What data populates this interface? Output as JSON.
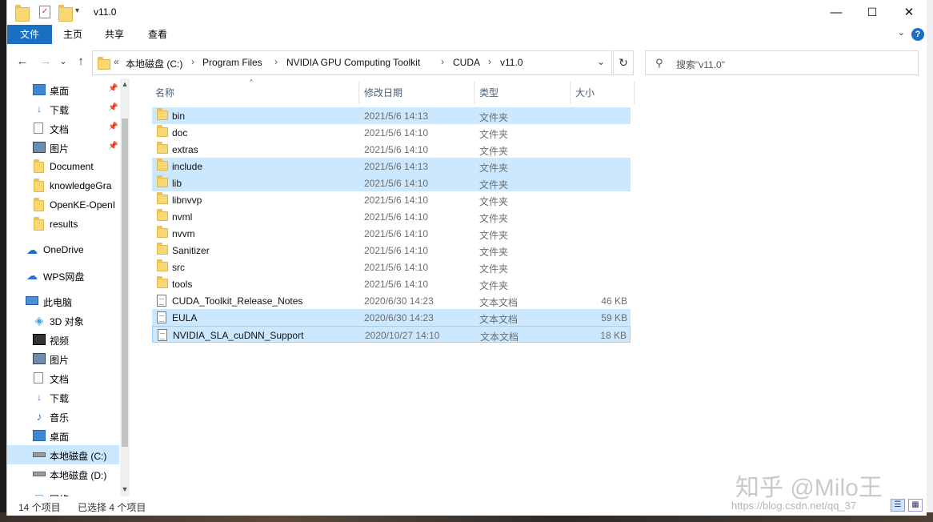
{
  "window": {
    "title": "v11.0",
    "controls": {
      "minimize": "—",
      "maximize": "☐",
      "close": "✕"
    }
  },
  "ribbon": {
    "tabs": [
      "文件",
      "主页",
      "共享",
      "查看"
    ],
    "help": "?"
  },
  "nav": {
    "back": "←",
    "forward": "→",
    "recent": "⌄",
    "up": "↑",
    "refresh": "↻",
    "breadcrumb_prefix": "«",
    "breadcrumb": [
      "本地磁盘 (C:)",
      "Program Files",
      "NVIDIA GPU Computing Toolkit",
      "CUDA",
      "v11.0"
    ],
    "dropdown": "⌄",
    "search_placeholder": "搜索\"v11.0\""
  },
  "sidebar": {
    "items": [
      {
        "label": "桌面",
        "icon": "desktop-icon",
        "pinned": true
      },
      {
        "label": "下载",
        "icon": "download-icon",
        "pinned": true
      },
      {
        "label": "文档",
        "icon": "document-icon",
        "pinned": true
      },
      {
        "label": "图片",
        "icon": "pictures-icon",
        "pinned": true
      },
      {
        "label": "Document",
        "icon": "folder-icon"
      },
      {
        "label": "knowledgeGra",
        "icon": "folder-icon"
      },
      {
        "label": "OpenKE-OpenI",
        "icon": "folder-icon"
      },
      {
        "label": "results",
        "icon": "folder-icon"
      },
      {
        "label": "OneDrive",
        "icon": "onedrive-icon"
      },
      {
        "label": "WPS网盘",
        "icon": "wps-cloud-icon"
      },
      {
        "label": "此电脑",
        "icon": "this-pc-icon"
      },
      {
        "label": "3D 对象",
        "icon": "3d-objects-icon"
      },
      {
        "label": "视频",
        "icon": "video-icon"
      },
      {
        "label": "图片",
        "icon": "pictures-icon"
      },
      {
        "label": "文档",
        "icon": "document-icon"
      },
      {
        "label": "下载",
        "icon": "download-icon"
      },
      {
        "label": "音乐",
        "icon": "music-icon"
      },
      {
        "label": "桌面",
        "icon": "desktop-icon"
      },
      {
        "label": "本地磁盘 (C:)",
        "icon": "drive-icon",
        "selected": true
      },
      {
        "label": "本地磁盘 (D:)",
        "icon": "drive-icon"
      },
      {
        "label": "网络",
        "icon": "network-icon"
      }
    ]
  },
  "columns": {
    "name": "名称",
    "date": "修改日期",
    "type": "类型",
    "size": "大小"
  },
  "files": [
    {
      "name": "bin",
      "date": "2021/5/6 14:13",
      "type": "文件夹",
      "size": "",
      "kind": "folder",
      "selected": true
    },
    {
      "name": "doc",
      "date": "2021/5/6 14:10",
      "type": "文件夹",
      "size": "",
      "kind": "folder"
    },
    {
      "name": "extras",
      "date": "2021/5/6 14:10",
      "type": "文件夹",
      "size": "",
      "kind": "folder"
    },
    {
      "name": "include",
      "date": "2021/5/6 14:13",
      "type": "文件夹",
      "size": "",
      "kind": "folder",
      "selected": true
    },
    {
      "name": "lib",
      "date": "2021/5/6 14:10",
      "type": "文件夹",
      "size": "",
      "kind": "folder",
      "selected": true
    },
    {
      "name": "libnvvp",
      "date": "2021/5/6 14:10",
      "type": "文件夹",
      "size": "",
      "kind": "folder"
    },
    {
      "name": "nvml",
      "date": "2021/5/6 14:10",
      "type": "文件夹",
      "size": "",
      "kind": "folder"
    },
    {
      "name": "nvvm",
      "date": "2021/5/6 14:10",
      "type": "文件夹",
      "size": "",
      "kind": "folder"
    },
    {
      "name": "Sanitizer",
      "date": "2021/5/6 14:10",
      "type": "文件夹",
      "size": "",
      "kind": "folder"
    },
    {
      "name": "src",
      "date": "2021/5/6 14:10",
      "type": "文件夹",
      "size": "",
      "kind": "folder"
    },
    {
      "name": "tools",
      "date": "2021/5/6 14:10",
      "type": "文件夹",
      "size": "",
      "kind": "folder"
    },
    {
      "name": "CUDA_Toolkit_Release_Notes",
      "date": "2020/6/30 14:23",
      "type": "文本文档",
      "size": "46 KB",
      "kind": "file"
    },
    {
      "name": "EULA",
      "date": "2020/6/30 14:23",
      "type": "文本文档",
      "size": "59 KB",
      "kind": "file",
      "selected": true
    },
    {
      "name": "NVIDIA_SLA_cuDNN_Support",
      "date": "2020/10/27 14:10",
      "type": "文本文档",
      "size": "18 KB",
      "kind": "file",
      "selected": true,
      "focused": true
    }
  ],
  "status": {
    "count": "14 个项目",
    "selected": "已选择 4 个项目"
  },
  "watermark": {
    "text": "知乎 @Milo王",
    "url": "https://blog.csdn.net/qq_37"
  },
  "colors": {
    "accent": "#1a6fc2",
    "selection": "#cce8ff",
    "folder": "#f8d775"
  }
}
